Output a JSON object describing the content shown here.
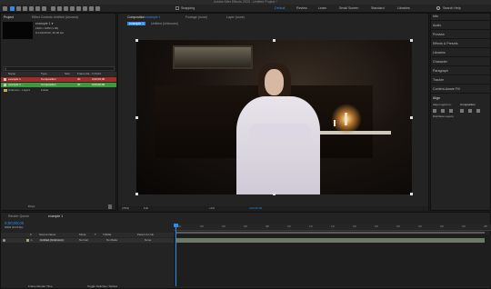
{
  "app": {
    "title": "Adobe After Effects 2023 - Untitled Project *"
  },
  "toolbar": {
    "snapping": "Snapping",
    "workspaces": [
      "Default",
      "Review",
      "Learn",
      "Small Screen",
      "Standard",
      "Libraries"
    ],
    "active_workspace": "Default",
    "search_placeholder": "Search Help"
  },
  "project": {
    "tab_label": "Project",
    "effect_controls": "Effect Controls Untitled (Unused)",
    "comp_name": "example 1 ▾",
    "comp_size": "1920 x 1080 (1.00)",
    "comp_duration": "Δ 0;00;05;00, 30.00 fps",
    "search_placeholder": "",
    "columns": [
      "Name",
      "Type",
      "Size",
      "Frame Ra...",
      "In Point"
    ],
    "rows": [
      {
        "name": "example 1",
        "type": "Composition",
        "size": "",
        "fps": "30",
        "inpoint": "0;00;00;00"
      },
      {
        "name": "example 1 ...",
        "type": "Composition",
        "size": "",
        "fps": "30",
        "inpoint": "0;00;00;00"
      },
      {
        "name": "Unknown - Layers",
        "type": "Folder",
        "size": "",
        "fps": "",
        "inpoint": ""
      }
    ],
    "bpc": "8 bpc"
  },
  "viewer": {
    "tab_label": "Composition",
    "comp_tab": "example 1",
    "footage_tab": "Footage (none)",
    "layer_tab": "Layer (none)",
    "breadcrumb": [
      "example 1",
      "Untitled (Unknown)"
    ],
    "zoom": "(79%)",
    "resolution": "Full",
    "timecode": "0;00;00;00",
    "exposure": "+0.0"
  },
  "right_panel": {
    "items": [
      "Info",
      "Audio",
      "Preview",
      "Effects & Presets",
      "Libraries",
      "Character",
      "Paragraph",
      "Tracker",
      "Content-Aware Fill",
      "Align"
    ],
    "align_to_label": "Align Layers to:",
    "align_to_value": "Composition",
    "distribute_label": "Distribute Layers:"
  },
  "timeline": {
    "render_queue": "Render Queue",
    "comp_tab": "example 1",
    "timecode": "0;00;00;00",
    "fps_note": "00000 (30.00 fps)",
    "columns": [
      "#",
      "Source Name",
      "Mode",
      "T",
      "TrkMat",
      "Parent & Link"
    ],
    "layer": {
      "index": "1",
      "name": "Untitled (Unknown)",
      "mode": "Normal",
      "trkmat": "No Matte",
      "parent": "None"
    },
    "ruler": [
      "0s",
      "02f",
      "04f",
      "06f",
      "08f",
      "10f",
      "12f",
      "14f",
      "16f",
      "18f",
      "20f",
      "22f",
      "24f",
      "26f",
      "28f"
    ],
    "footer_left": "Frame Render Time",
    "footer_right": "Toggle Switches / Modes"
  },
  "colors": {
    "accent": "#2d8ceb",
    "selected_row": "#a42b2b",
    "green_row": "#3c9a3c",
    "layer_bar": "#6b7a66"
  }
}
